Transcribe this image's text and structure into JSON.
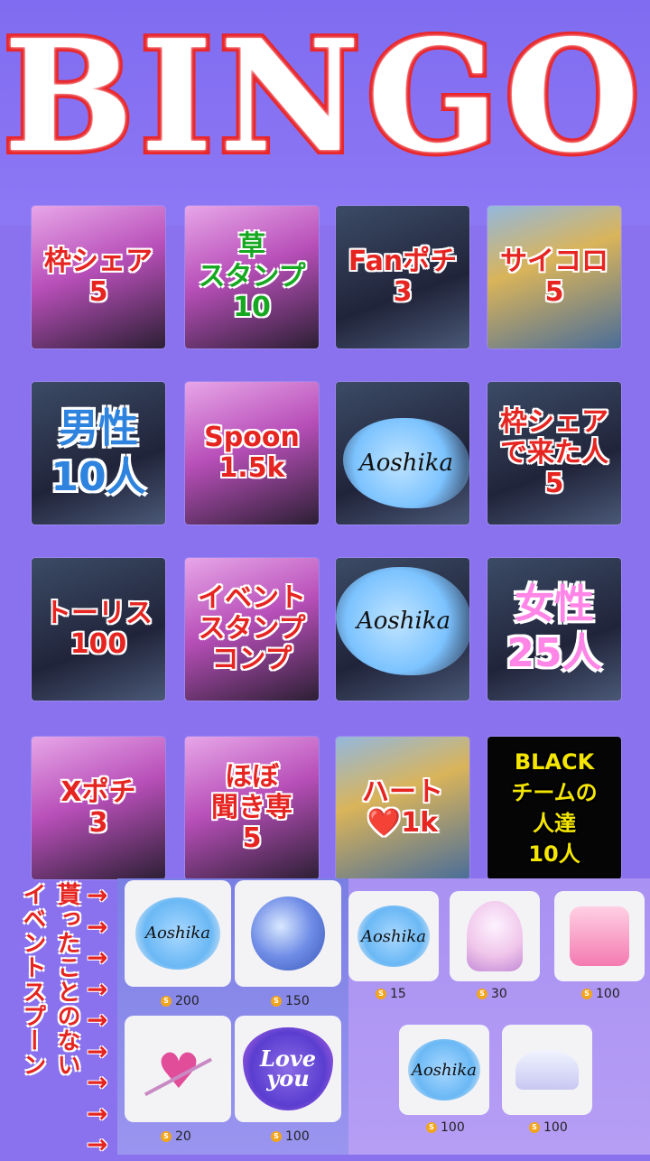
{
  "title": "BINGO",
  "bingo": {
    "cells": [
      {
        "label": "枠シェア\n5",
        "style": "red",
        "bg": "pink"
      },
      {
        "label": "草\nスタンプ\n10",
        "style": "green",
        "bg": "pink"
      },
      {
        "label": "Fanポチ\n3",
        "style": "red",
        "bg": "dark"
      },
      {
        "label": "サイコロ\n5",
        "style": "red",
        "bg": "gold"
      },
      {
        "label": "男性\n10人",
        "style": "blue",
        "bg": "dark"
      },
      {
        "label": "Spoon\n1.5k",
        "style": "red",
        "bg": "pink"
      },
      {
        "label": "",
        "style": "red",
        "bg": "dark",
        "stamp": "Aoshika"
      },
      {
        "label": "枠シェア\nで来た人\n5",
        "style": "red",
        "bg": "dark"
      },
      {
        "label": "トーリス\n100",
        "style": "red",
        "bg": "dark"
      },
      {
        "label": "イベント\nスタンプ\nコンプ",
        "style": "red",
        "bg": "pink"
      },
      {
        "label": "",
        "style": "red",
        "bg": "dark",
        "stamp": "Aoshika"
      },
      {
        "label": "女性\n25人",
        "style": "pinkt",
        "bg": "dark"
      },
      {
        "label": "Xポチ\n3",
        "style": "red",
        "bg": "pink"
      },
      {
        "label": "ほぼ\n聞き専\n5",
        "style": "red",
        "bg": "pink"
      },
      {
        "label": "ハート\n❤️1k",
        "style": "red",
        "bg": "gold"
      },
      {
        "label": "BLACK\nチームの\n人達\n10人",
        "style": "yellow",
        "bg": "black"
      }
    ]
  },
  "side_note": {
    "line1": "貰ったことのない",
    "line2": "イベントスプーン",
    "arrow": "→"
  },
  "gifts_left": [
    {
      "kind": "stamp",
      "name": "Aoshika",
      "price": "200"
    },
    {
      "kind": "bouquet",
      "name": "",
      "price": "150"
    },
    {
      "kind": "arrow",
      "name": "",
      "price": "20"
    },
    {
      "kind": "loveyou",
      "name": "Love you",
      "price": "100"
    }
  ],
  "gifts_right": [
    {
      "kind": "stamp",
      "name": "Aoshika",
      "price": "15"
    },
    {
      "kind": "globe",
      "name": "",
      "price": "30"
    },
    {
      "kind": "cake",
      "name": "",
      "price": "100"
    },
    {
      "kind": "stamp",
      "name": "Aoshika",
      "price": "100"
    },
    {
      "kind": "tiara",
      "name": "",
      "price": "100"
    }
  ],
  "coin_symbol": "S",
  "colors": {
    "title_red": "#e9262a",
    "bg": "#8a72ee",
    "coin": "#f2a51b"
  }
}
